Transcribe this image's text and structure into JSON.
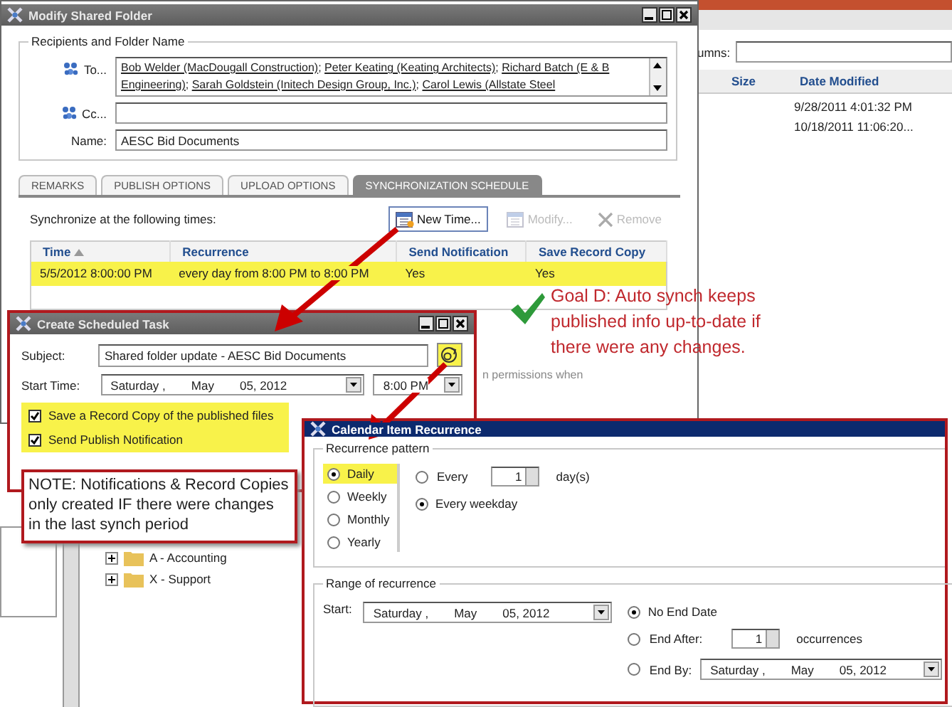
{
  "background_app": {
    "columns_label": "umns:",
    "columns": [
      "Size",
      "Date Modified"
    ],
    "rows": [
      "9/28/2011 4:01:32 PM",
      "10/18/2011 11:06:20..."
    ],
    "tree": [
      {
        "label": "A - Accounting",
        "expanded": false
      },
      {
        "label": "X - Support",
        "expanded": false
      }
    ]
  },
  "modify_window": {
    "title": "Modify Shared Folder",
    "group_label": "Recipients and Folder Name",
    "to": {
      "label": "To...",
      "separator": ";",
      "recipients": [
        "Bob Welder (MacDougall Construction)",
        "Peter Keating (Keating Architects)",
        "Richard Batch (E & B Engineering)",
        "Sarah Goldstein (Initech Design Group, Inc.)",
        "Carol Lewis (Allstate Steel"
      ]
    },
    "cc": {
      "label": "Cc..."
    },
    "name": {
      "label": "Name:",
      "value": "AESC Bid Documents"
    },
    "tabs": [
      {
        "label": "REMARKS",
        "selected": false
      },
      {
        "label": "PUBLISH OPTIONS",
        "selected": false
      },
      {
        "label": "UPLOAD OPTIONS",
        "selected": false
      },
      {
        "label": "SYNCHRONIZATION SCHEDULE",
        "selected": true
      }
    ],
    "caption": "Synchronize at the following times:",
    "buttons": [
      {
        "kind": "calendar",
        "label": "New Time...",
        "disabled": false
      },
      {
        "kind": "calendar",
        "label": "Modify...",
        "disabled": true
      },
      {
        "kind": "remove",
        "label": "Remove",
        "disabled": true
      }
    ],
    "table": {
      "columns": [
        {
          "label": "Time",
          "sorted": true
        },
        {
          "label": "Recurrence",
          "sorted": false
        },
        {
          "label": "Send Notification",
          "sorted": false
        },
        {
          "label": "Save Record Copy",
          "sorted": false
        }
      ],
      "rows": [
        {
          "cells": [
            "5/5/2012 8:00:00 PM",
            "every day from 8:00 PM to 8:00 PM",
            "Yes",
            "Yes"
          ],
          "highlighted": true
        }
      ]
    },
    "hidden_text": "n permissions when"
  },
  "task_window": {
    "title": "Create Scheduled Task",
    "subject": {
      "label": "Subject:",
      "value": "Shared folder update - AESC Bid Documents"
    },
    "recurrence_button_highlighted": true,
    "start": {
      "label": "Start Time:",
      "date": [
        "Saturday ,",
        "May",
        "05, 2012"
      ],
      "time": "8:00 PM"
    },
    "options_highlighted": true,
    "options": [
      {
        "label": "Save a Record Copy of the published files",
        "checked": true
      },
      {
        "label": "Send Publish Notification",
        "checked": true
      }
    ]
  },
  "recurrence_window": {
    "title": "Calendar Item Recurrence",
    "pattern": {
      "label": "Recurrence pattern",
      "types": [
        {
          "label": "Daily",
          "selected": true,
          "highlighted": true
        },
        {
          "label": "Weekly",
          "selected": false,
          "highlighted": false
        },
        {
          "label": "Monthly",
          "selected": false,
          "highlighted": false
        },
        {
          "label": "Yearly",
          "selected": false,
          "highlighted": false
        }
      ],
      "options": [
        {
          "kind": "interval",
          "label": "Every",
          "value": "1",
          "unit": "day(s)",
          "selected": false
        },
        {
          "kind": "plain",
          "label": "Every weekday",
          "selected": true
        }
      ]
    },
    "range": {
      "label": "Range of recurrence",
      "start_label": "Start:",
      "start_date": [
        "Saturday ,",
        "May",
        "05, 2012"
      ],
      "ends": [
        {
          "kind": "plain",
          "label": "No End Date",
          "selected": true
        },
        {
          "kind": "count",
          "label": "End After:",
          "value": "1",
          "unit": "occurrences",
          "selected": false
        },
        {
          "kind": "date",
          "label": "End By:",
          "date": [
            "Saturday ,",
            "May",
            "05, 2012"
          ],
          "selected": false
        }
      ]
    }
  },
  "note": "NOTE:  Notifications & Record Copies only created IF there were changes in the last synch period",
  "goal": "Goal D:  Auto synch keeps published info up-to-date if there were any changes."
}
